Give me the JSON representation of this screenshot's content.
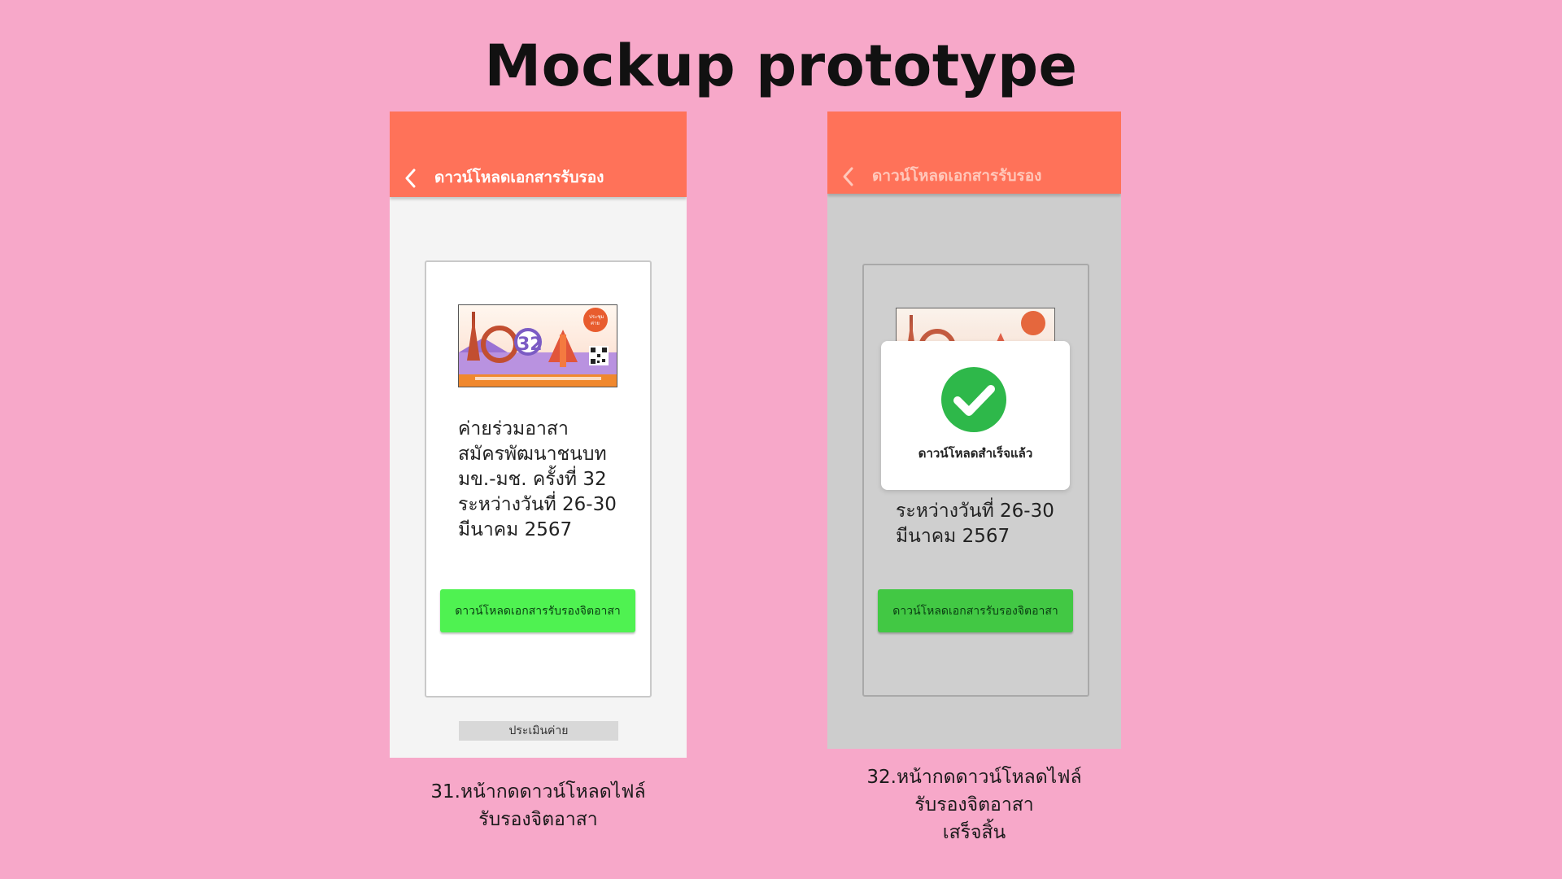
{
  "slide": {
    "title": "Mockup prototype",
    "background": "#f7a8c9"
  },
  "screen1": {
    "header_title": "ดาวน์โหลดเอกสารรับรอง",
    "camp_lines": [
      "ค่ายร่วมอาสา",
      "สมัครพัฒนาชนบท",
      "มข.-มช. ครั้งที่ 32",
      "ระหว่างวันที่ 26-30",
      "มีนาคม 2567"
    ],
    "download_button": "ดาวน์โหลดเอกสารรับรองจิตอาสา",
    "evaluate_button": "ประเมินค่าย",
    "caption_lines": [
      "31.หน้ากดดาวน์โหลดไฟล์",
      "รับรองจิตอาสา"
    ]
  },
  "screen2": {
    "header_title": "ดาวน์โหลดเอกสารรับรอง",
    "camp_lines_visible": [
      "ระหว่างวันที่ 26-30",
      "มีนาคม 2567"
    ],
    "download_button": "ดาวน์โหลดเอกสารรับรองจิตอาสา",
    "success_message": "ดาวน์โหลดสำเร็จแล้ว",
    "caption_lines": [
      "32.หน้ากดดาวน์โหลดไฟล์",
      "รับรองจิตอาสา",
      "เสร็จสิ้น"
    ]
  },
  "poster": {
    "badge_text": [
      "ประชุม",
      "ค่าย"
    ],
    "logo_text": "32"
  },
  "colors": {
    "appbar": "#ff7259",
    "button": "#4ff251",
    "success": "#2eb84a"
  },
  "icons": [
    "back-chevron-icon",
    "check-circle-icon",
    "qr-code-icon"
  ]
}
